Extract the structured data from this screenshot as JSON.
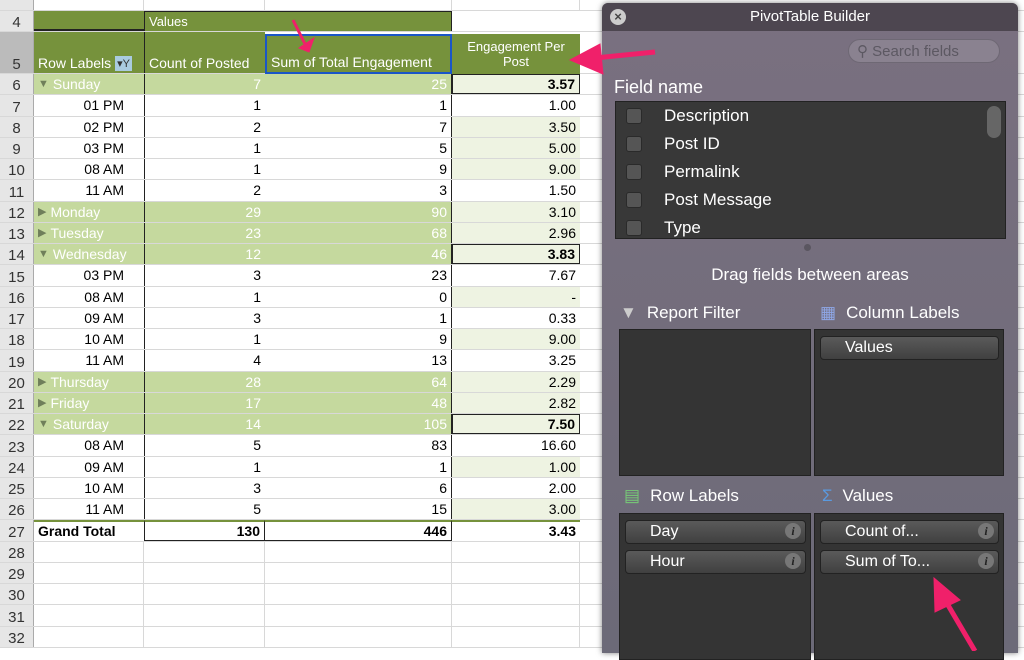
{
  "row_numbers": [
    "4",
    "5",
    "6",
    "7",
    "8",
    "9",
    "10",
    "11",
    "12",
    "13",
    "14",
    "15",
    "16",
    "17",
    "18",
    "19",
    "20",
    "21",
    "22",
    "23",
    "24",
    "25",
    "26",
    "27",
    "28",
    "29",
    "30",
    "31",
    "32"
  ],
  "pivot": {
    "values_label": "Values",
    "headers": {
      "row_labels": "Row Labels",
      "count": "Count of Posted",
      "sum": "Sum of Total Engagement",
      "engagement": "Engagement Per Post"
    },
    "rows": [
      {
        "type": "day",
        "expanded": true,
        "label": "Sunday",
        "count": "7",
        "sum": "25",
        "epp": "3.57"
      },
      {
        "type": "hour",
        "label": "01 PM",
        "count": "1",
        "sum": "1",
        "epp": "1.00"
      },
      {
        "type": "hour",
        "label": "02 PM",
        "count": "2",
        "sum": "7",
        "epp": "3.50"
      },
      {
        "type": "hour",
        "label": "03 PM",
        "count": "1",
        "sum": "5",
        "epp": "5.00"
      },
      {
        "type": "hour",
        "label": "08 AM",
        "count": "1",
        "sum": "9",
        "epp": "9.00"
      },
      {
        "type": "hour",
        "label": "11 AM",
        "count": "2",
        "sum": "3",
        "epp": "1.50"
      },
      {
        "type": "day",
        "expanded": false,
        "label": "Monday",
        "count": "29",
        "sum": "90",
        "epp": "3.10"
      },
      {
        "type": "day",
        "expanded": false,
        "label": "Tuesday",
        "count": "23",
        "sum": "68",
        "epp": "2.96"
      },
      {
        "type": "day",
        "expanded": true,
        "label": "Wednesday",
        "count": "12",
        "sum": "46",
        "epp": "3.83"
      },
      {
        "type": "hour",
        "label": "03 PM",
        "count": "3",
        "sum": "23",
        "epp": "7.67"
      },
      {
        "type": "hour",
        "label": "08 AM",
        "count": "1",
        "sum": "0",
        "epp": "-"
      },
      {
        "type": "hour",
        "label": "09 AM",
        "count": "3",
        "sum": "1",
        "epp": "0.33"
      },
      {
        "type": "hour",
        "label": "10 AM",
        "count": "1",
        "sum": "9",
        "epp": "9.00"
      },
      {
        "type": "hour",
        "label": "11 AM",
        "count": "4",
        "sum": "13",
        "epp": "3.25"
      },
      {
        "type": "day",
        "expanded": false,
        "label": "Thursday",
        "count": "28",
        "sum": "64",
        "epp": "2.29"
      },
      {
        "type": "day",
        "expanded": false,
        "label": "Friday",
        "count": "17",
        "sum": "48",
        "epp": "2.82"
      },
      {
        "type": "day",
        "expanded": true,
        "label": "Saturday",
        "count": "14",
        "sum": "105",
        "epp": "7.50"
      },
      {
        "type": "hour",
        "label": "08 AM",
        "count": "5",
        "sum": "83",
        "epp": "16.60"
      },
      {
        "type": "hour",
        "label": "09 AM",
        "count": "1",
        "sum": "1",
        "epp": "1.00"
      },
      {
        "type": "hour",
        "label": "10 AM",
        "count": "3",
        "sum": "6",
        "epp": "2.00"
      },
      {
        "type": "hour",
        "label": "11 AM",
        "count": "5",
        "sum": "15",
        "epp": "3.00"
      }
    ],
    "grand_total": {
      "label": "Grand Total",
      "count": "130",
      "sum": "446",
      "epp": "3.43"
    }
  },
  "panel": {
    "title": "PivotTable Builder",
    "search_placeholder": "Search fields",
    "field_name_label": "Field name",
    "fields": [
      "Description",
      "Post ID",
      "Permalink",
      "Post Message",
      "Type"
    ],
    "drag_hint": "Drag fields between areas",
    "report_filter": {
      "label": "Report Filter",
      "items": []
    },
    "column_labels": {
      "label": "Column Labels",
      "items": [
        "Values"
      ]
    },
    "row_labels": {
      "label": "Row Labels",
      "items": [
        "Day",
        "Hour"
      ]
    },
    "values": {
      "label": "Values",
      "items": [
        "Count of...",
        "Sum of To..."
      ]
    }
  },
  "colors": {
    "header_green": "#76923c",
    "day_row_green": "#c5d99e",
    "annotation_pink": "#f0206a",
    "selection_blue": "#1a56c8"
  }
}
